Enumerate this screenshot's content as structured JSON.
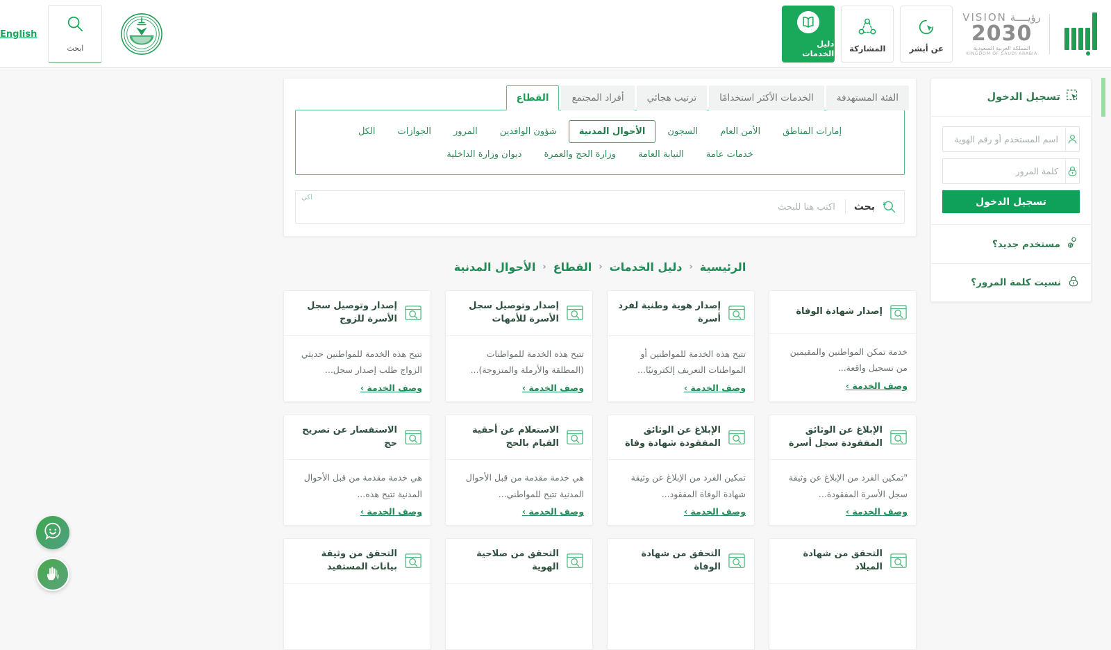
{
  "header": {
    "moi_logo_alt": "شعار وزارة الداخلية",
    "search_tile": {
      "label": "ابحث",
      "icon": "search-icon"
    },
    "language_link": "English",
    "tiles": [
      {
        "label": "دليل الخدمات",
        "icon": "book-icon",
        "active": true
      },
      {
        "label": "المشاركة",
        "icon": "share-network-icon",
        "active": false
      },
      {
        "label": "عن أبشر",
        "icon": "cursor-circle-icon",
        "active": false
      }
    ],
    "vision": {
      "line1": "VISION",
      "line1_ar": "رؤيــــة",
      "line2": "2030",
      "line3": "المملكة العربية السعودية",
      "line4": "KINGDOM OF SAUDI ARABIA"
    }
  },
  "login": {
    "title": "تسجيل الدخول",
    "username_placeholder": "اسم المستخدم أو رقم الهوية",
    "username_value": "",
    "password_placeholder": "كلمة المرور",
    "password_value": "",
    "submit_label": "تسجيل الدخول",
    "new_user_label": "مستخدم جديد؟",
    "forgot_label": "نسيت كلمة المرور؟"
  },
  "tabs": [
    {
      "label": "الفئة المستهدفة",
      "active": false
    },
    {
      "label": "الخدمات الأكثر استخدامًا",
      "active": false
    },
    {
      "label": "ترتيب هجائي",
      "active": false
    },
    {
      "label": "أفراد المجتمع",
      "active": false
    },
    {
      "label": "القطاع",
      "active": true
    }
  ],
  "sector_chips_row1": [
    {
      "label": "إمارات المناطق",
      "active": false
    },
    {
      "label": "الأمن العام",
      "active": false
    },
    {
      "label": "السجون",
      "active": false
    },
    {
      "label": "الأحوال المدنية",
      "active": true
    },
    {
      "label": "شؤون الوافدين",
      "active": false
    },
    {
      "label": "المرور",
      "active": false
    },
    {
      "label": "الجوازات",
      "active": false
    },
    {
      "label": "الكل",
      "active": false
    }
  ],
  "sector_chips_row2": [
    {
      "label": "خدمات عامة",
      "active": false
    },
    {
      "label": "النيابة العامة",
      "active": false
    },
    {
      "label": "وزارة الحج والعمرة",
      "active": false
    },
    {
      "label": "ديوان وزارة الداخلية",
      "active": false
    }
  ],
  "search": {
    "button_label": "بحث",
    "placeholder": "اكتب هنا للبحث",
    "value": "",
    "ghost_text": "اكي"
  },
  "breadcrumb": {
    "separator": "‹",
    "items": [
      "الرئيسية",
      "دليل الخدمات",
      "القطاع",
      "الأحوال المدنية"
    ]
  },
  "cards_link_label": "وصف الخدمة ›",
  "cards": [
    {
      "title": "إصدار شهادة الوفاة",
      "desc": "خدمة تمكن المواطنين والمقيمين من تسجيل واقعة...",
      "link": "وصف الخدمة ›"
    },
    {
      "title": "إصدار هوية وطنية لفرد أسرة",
      "desc": "تتيح هذه الخدمة للمواطنين أو المواطنات التعريف إلكترونيًا...",
      "link": "وصف الخدمة ›"
    },
    {
      "title": "إصدار وتوصيل سجل الأسرة للأمهات",
      "desc": "تتيح هذه الخدمة للمواطنات (المطلقة والأرملة والمتزوجة)...",
      "link": "وصف الخدمة ›"
    },
    {
      "title": "إصدار وتوصيل سجل الأسرة للزوج",
      "desc": "تتيح هذه الخدمة للمواطنين حديثي الزواج طلب إصدار سجل...",
      "link": "وصف الخدمة ›"
    },
    {
      "title": "الإبلاغ عن الوثائق المفقودة سجل أسرة",
      "desc": "\"تمكين الفرد من الإبلاغ عن وثيقة سجل الأسرة المفقودة...",
      "link": "وصف الخدمة ›"
    },
    {
      "title": "الإبلاغ عن الوثائق المفقودة شهادة وفاة",
      "desc": "تمكين الفرد من الإبلاغ عن وثيقة شهادة الوفاة المفقود...",
      "link": "وصف الخدمة ›"
    },
    {
      "title": "الاستعلام عن أحقية القيام بالحج",
      "desc": "هي خدمة مقدمة من قبل الأحوال المدنية تتيح للمواطني...",
      "link": "وصف الخدمة ›"
    },
    {
      "title": "الاستفسار عن تصريح حج",
      "desc": "هي خدمة مقدمة من قبل الأحوال المدنية تتيح هذه...",
      "link": "وصف الخدمة ›"
    },
    {
      "title": "التحقق من شهادة الميلاد",
      "desc": "",
      "link": ""
    },
    {
      "title": "التحقق من شهادة الوفاة",
      "desc": "",
      "link": ""
    },
    {
      "title": "التحقق من صلاحية الهوية",
      "desc": "",
      "link": ""
    },
    {
      "title": "التحقق من وثيقة بيانات المستفيد",
      "desc": "",
      "link": ""
    }
  ],
  "fabs": [
    {
      "name": "chat-bot-button",
      "icon": "smiley-chat-icon"
    },
    {
      "name": "sign-language-button",
      "icon": "hands-sign-language-icon"
    }
  ],
  "colors": {
    "brand_green": "#0fa05a",
    "accent_green": "#1aa85a",
    "light_green": "#93e09f",
    "text_dark": "#2f4f3f",
    "muted": "#6c7272"
  }
}
